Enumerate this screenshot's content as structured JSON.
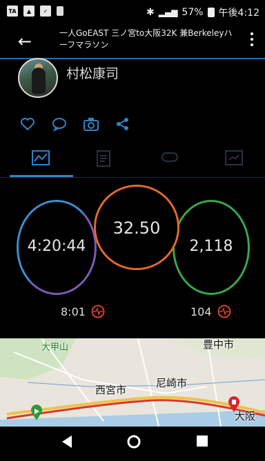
{
  "status_bar": {
    "left_icons": [
      "TA",
      "image-icon",
      "shield-icon",
      "notification-icon"
    ],
    "battery": "57%",
    "time": "午後4:12"
  },
  "header": {
    "title": "一人GoEAST 三ノ宮to大阪32K 兼Berkeleyハーフマラソン"
  },
  "profile": {
    "name": "村松康司"
  },
  "stats": {
    "time": "4:20:44",
    "distance": "32.50",
    "calories": "2,118",
    "pace": "8:01",
    "heart_rate": "104"
  },
  "map": {
    "labels": {
      "kabutoyama": "大甲山",
      "toyonaka": "豊中市",
      "nishinomiya": "西宮市",
      "amagasaki": "尼崎市",
      "osaka": "大阪"
    }
  },
  "colors": {
    "accent": "#2e84c8",
    "time_ring": "#7d5ab8",
    "distance_ring": "#e06a2a",
    "calories_ring": "#3aa84a",
    "heart": "#d9432a"
  }
}
